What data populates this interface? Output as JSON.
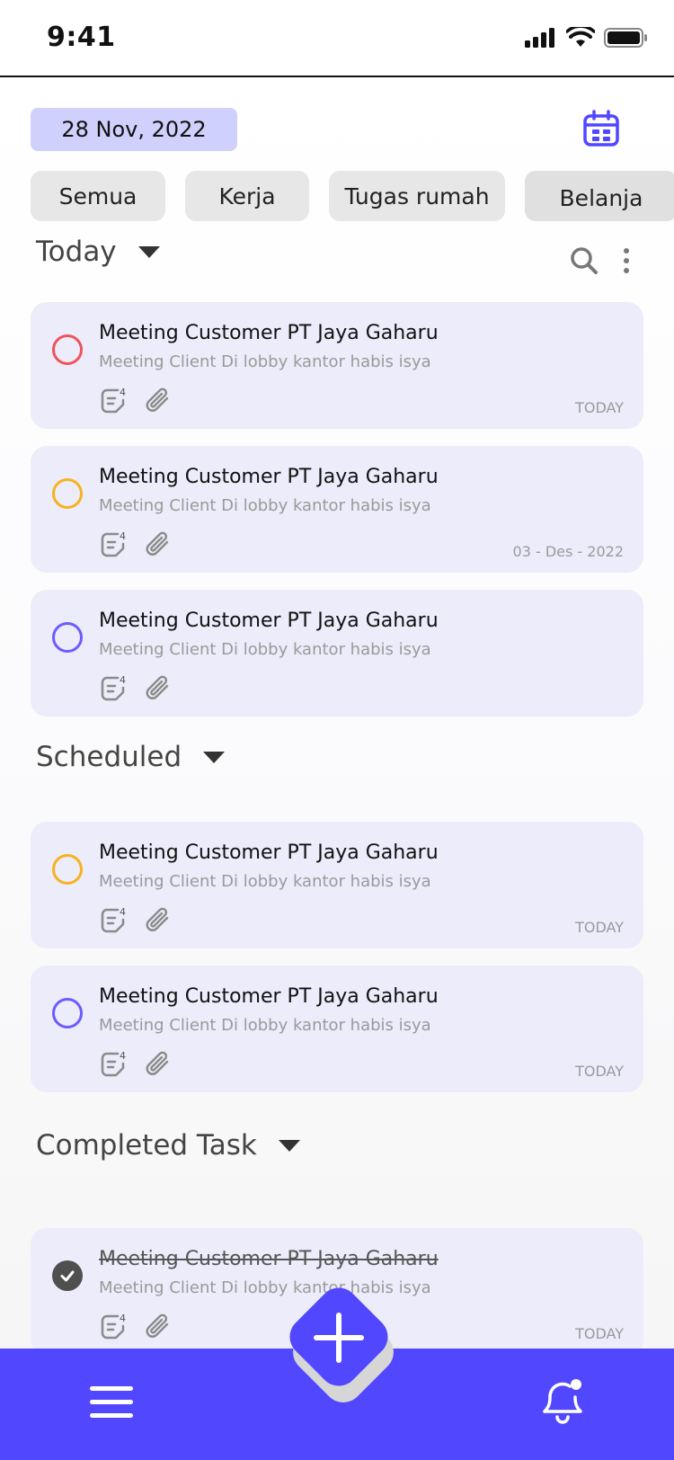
{
  "status_bar": {
    "time": "9:41"
  },
  "header": {
    "date": "28 Nov, 2022"
  },
  "filters": [
    "Semua",
    "Kerja",
    "Tugas rumah",
    "Belanja"
  ],
  "sections": {
    "today": "Today",
    "scheduled": "Scheduled",
    "completed": "Completed Task"
  },
  "tasks": [
    {
      "title": "Meeting Customer PT Jaya Gaharu",
      "subtitle": "Meeting Client Di lobby kantor habis isya",
      "note_count": "4",
      "when": "TODAY",
      "color": "#f0535b"
    },
    {
      "title": "Meeting Customer PT Jaya Gaharu",
      "subtitle": "Meeting Client Di lobby kantor habis isya",
      "note_count": "4",
      "when": "03 - Des - 2022",
      "color": "#f7b31d"
    },
    {
      "title": "Meeting Customer PT Jaya Gaharu",
      "subtitle": "Meeting Client Di lobby kantor habis isya",
      "note_count": "4",
      "when": "",
      "color": "#6a5cff"
    },
    {
      "title": "Meeting Customer PT Jaya Gaharu",
      "subtitle": "Meeting Client Di lobby kantor habis isya",
      "note_count": "4",
      "when": "TODAY",
      "color": "#f7b31d"
    },
    {
      "title": "Meeting Customer PT Jaya Gaharu",
      "subtitle": "Meeting Client Di lobby kantor habis isya",
      "note_count": "4",
      "when": "TODAY",
      "color": "#6a5cff"
    },
    {
      "title": "Meeting Customer PT Jaya Gaharu",
      "subtitle": "Meeting Client Di lobby kantor habis isya",
      "note_count": "4",
      "when": "TODAY",
      "color": "#4f4f4f",
      "completed": true
    }
  ],
  "theme": {
    "accent": "#5147ff",
    "date_chip": "#cfd0fb",
    "card_bg": "#ececfa"
  },
  "icons": [
    "signal-icon",
    "wifi-icon",
    "battery-icon",
    "calendar-icon",
    "search-icon",
    "more-vertical-icon",
    "note-icon",
    "paperclip-icon",
    "check-icon",
    "menu-icon",
    "plus-icon",
    "bell-icon"
  ]
}
